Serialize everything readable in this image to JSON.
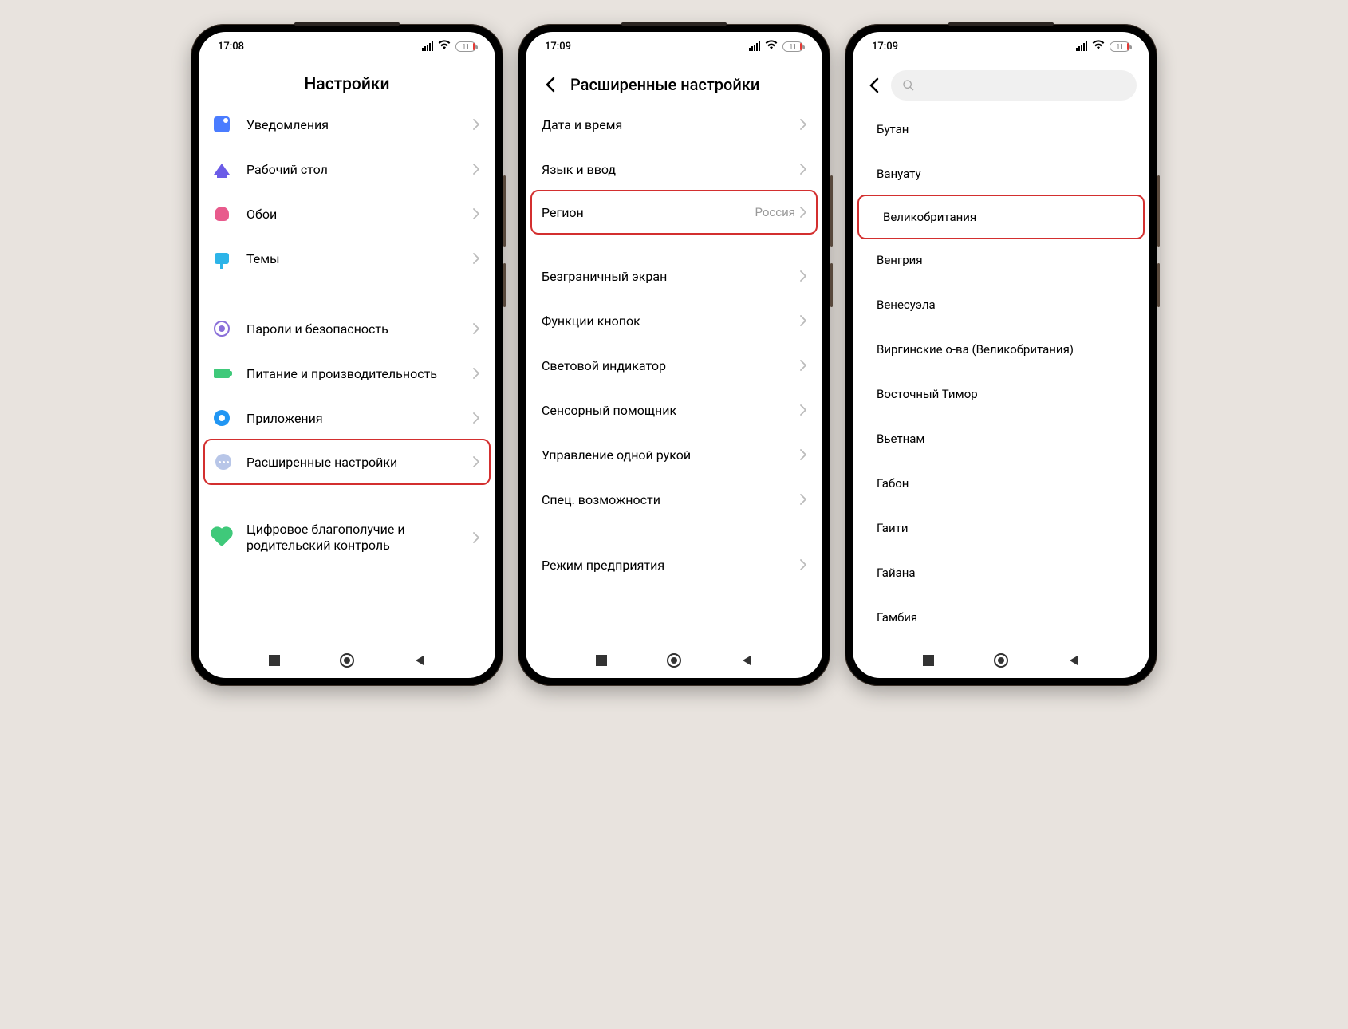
{
  "status": {
    "time_a": "17:08",
    "time_b": "17:09",
    "time_c": "17:09",
    "battery": "11"
  },
  "screen1": {
    "title": "Настройки",
    "items_g1": [
      {
        "label": "Уведомления",
        "icon": "bell"
      },
      {
        "label": "Рабочий стол",
        "icon": "home"
      },
      {
        "label": "Обои",
        "icon": "tulip"
      },
      {
        "label": "Темы",
        "icon": "brush"
      }
    ],
    "items_g2": [
      {
        "label": "Пароли и безопасность",
        "icon": "target"
      },
      {
        "label": "Питание и производительность",
        "icon": "batt"
      },
      {
        "label": "Приложения",
        "icon": "gear"
      },
      {
        "label": "Расширенные настройки",
        "icon": "dots",
        "highlight": true
      }
    ],
    "items_g3": [
      {
        "label": "Цифровое благополучие и родительский контроль",
        "icon": "heart"
      }
    ]
  },
  "screen2": {
    "title": "Расширенные настройки",
    "g1": [
      {
        "label": "Дата и время"
      },
      {
        "label": "Язык и ввод"
      },
      {
        "label": "Регион",
        "value": "Россия",
        "highlight": true
      }
    ],
    "g2": [
      {
        "label": "Безграничный экран"
      },
      {
        "label": "Функции кнопок"
      },
      {
        "label": "Световой индикатор"
      },
      {
        "label": "Сенсорный помощник"
      },
      {
        "label": "Управление одной рукой"
      },
      {
        "label": "Спец. возможности"
      }
    ],
    "g3": [
      {
        "label": "Режим предприятия"
      }
    ]
  },
  "screen3": {
    "regions": [
      {
        "label": "Бутан"
      },
      {
        "label": "Вануату"
      },
      {
        "label": "Великобритания",
        "highlight": true
      },
      {
        "label": "Венгрия"
      },
      {
        "label": "Венесуэла"
      },
      {
        "label": "Виргинские о-ва (Великобритания)"
      },
      {
        "label": "Восточный Тимор"
      },
      {
        "label": "Вьетнам"
      },
      {
        "label": "Габон"
      },
      {
        "label": "Гаити"
      },
      {
        "label": "Гайана"
      },
      {
        "label": "Гамбия"
      }
    ]
  }
}
